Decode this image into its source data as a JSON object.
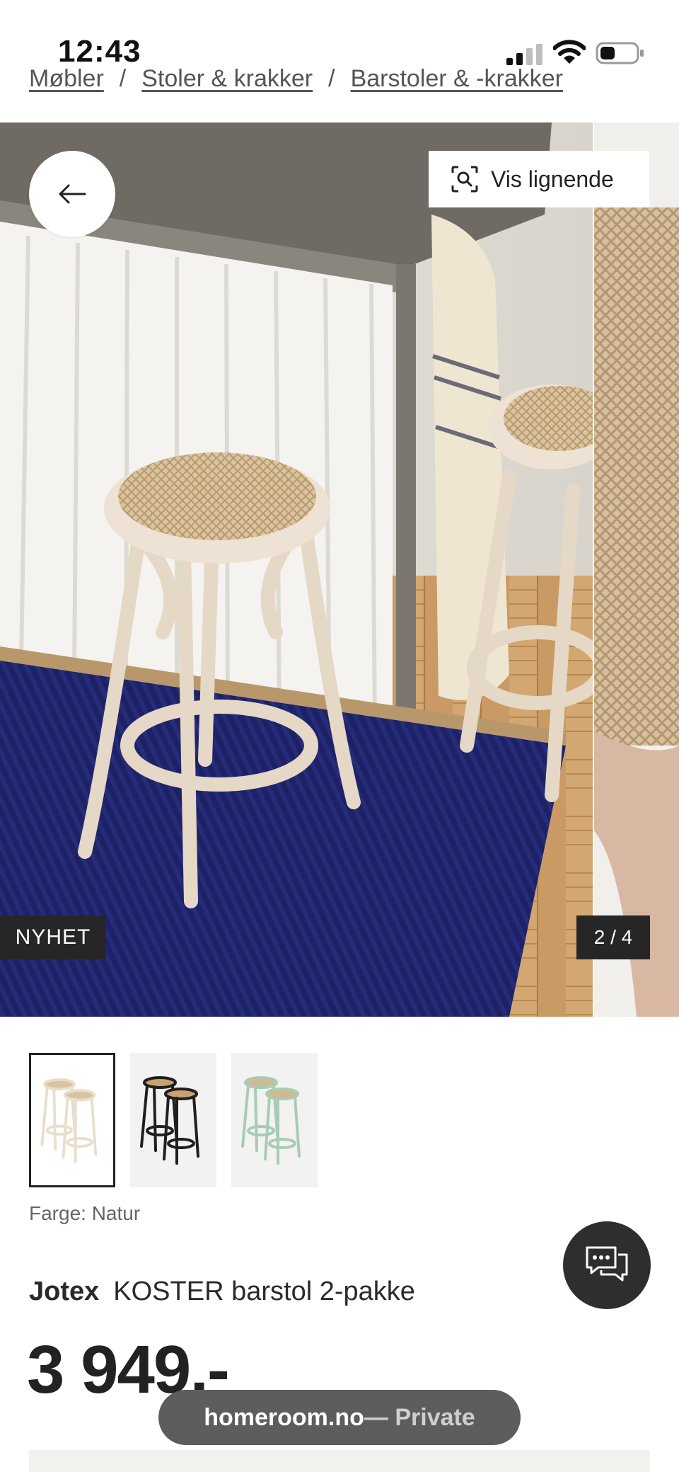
{
  "status_bar": {
    "time": "12:43"
  },
  "breadcrumb": {
    "items": [
      "Møbler",
      "Stoler & krakker",
      "Barstoler & -krakker"
    ],
    "separator": "/"
  },
  "gallery": {
    "similar_button_label": "Vis lignende",
    "badge": "NYHET",
    "counter": "2 / 4"
  },
  "thumbnails": [
    {
      "name": "Natur",
      "color": "#e9ddcc",
      "selected": true
    },
    {
      "name": "Svart",
      "color": "#1f1f1f",
      "selected": false
    },
    {
      "name": "Grønn",
      "color": "#a9cbb6",
      "selected": false
    }
  ],
  "product": {
    "color_label": "Farge: Natur",
    "brand": "Jotex",
    "name": "KOSTER barstol 2-pakke",
    "price": "3 949,-"
  },
  "browser": {
    "domain": "homeroom.no",
    "mode": " — Private"
  },
  "icons": {
    "back": "arrow-left-icon",
    "similar": "visual-search-icon",
    "chat": "chat-bubbles-icon",
    "signal": "cellular-signal-icon",
    "wifi": "wifi-icon",
    "battery": "battery-icon"
  },
  "colors": {
    "badge_bg": "#262626",
    "chat_bg": "#2e2e2e",
    "rug": "#1d2266",
    "url_pill": "#5d5d5d"
  }
}
